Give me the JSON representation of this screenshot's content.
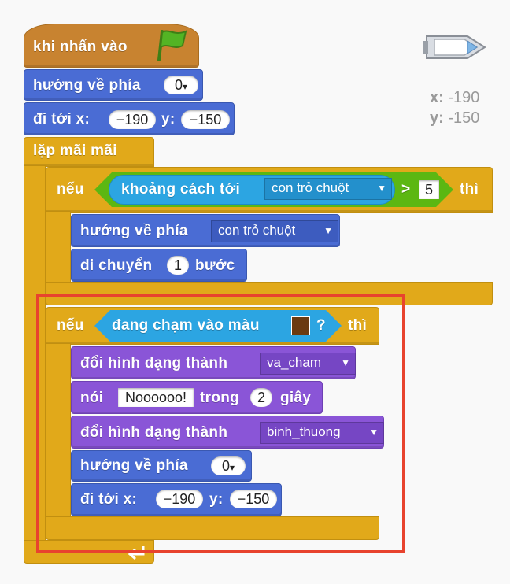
{
  "sprite_info": {
    "x_label": "x:",
    "x_value": "-190",
    "y_label": "y: ",
    "y_value": "-150"
  },
  "hat": {
    "label": "khi nhấn vào",
    "flag_icon": "green-flag-icon"
  },
  "point_dir_1": {
    "label": "hướng về phía",
    "value": "0",
    "arrow": "▾"
  },
  "goto_1": {
    "label": "đi tới x:",
    "x": "−190",
    "y_label": "y:",
    "y": "−150"
  },
  "forever": {
    "label": "lặp mãi mãi"
  },
  "if1": {
    "label": "nếu",
    "then": "thì",
    "dist_label": "khoảng cách tới",
    "dist_target": "con trỏ chuột",
    "dd_arrow": "▼",
    "op": ">",
    "compare_value": "5",
    "point_label": "hướng về phía",
    "point_target": "con trỏ chuột",
    "move_label": "di chuyển",
    "move_steps": "1",
    "move_unit": "bước"
  },
  "if2": {
    "label": "nếu",
    "then": "thì",
    "touch_label": "đang chạm vào màu",
    "touch_color": "#6b3a10",
    "q": "?",
    "costume_label": "đổi hình dạng thành",
    "costume_1": "va_cham",
    "say_label": "nói",
    "say_text": "Noooooo!",
    "say_for": "trong",
    "say_secs": "2",
    "say_unit": "giây",
    "costume_2": "binh_thuong",
    "point_label": "hướng về phía",
    "point_value": "0",
    "goto_label": "đi tới x:",
    "goto_x": "−190",
    "goto_y_label": "y:",
    "goto_y": "−150"
  },
  "colors": {
    "highlight": "#e8432e"
  }
}
